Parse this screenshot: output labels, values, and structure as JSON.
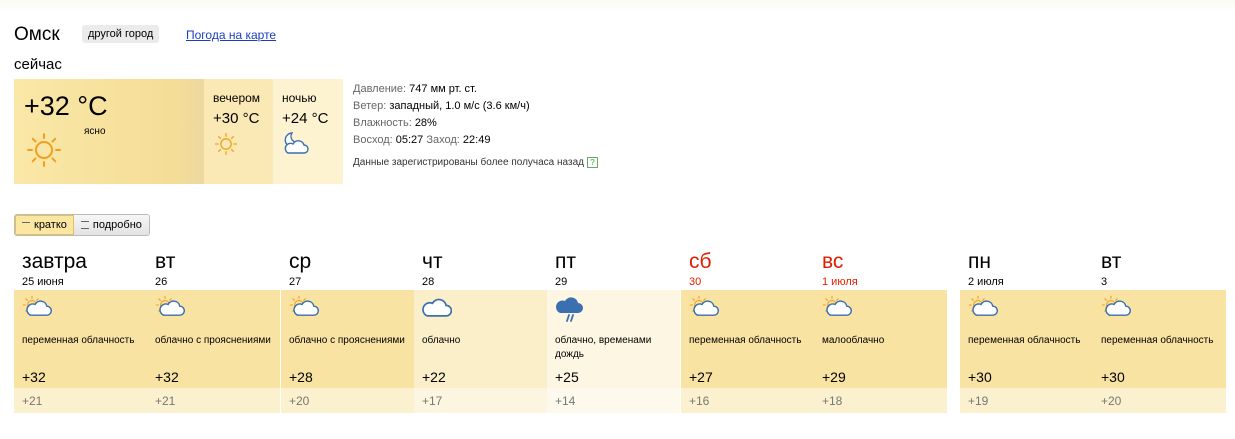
{
  "header": {
    "city": "Омск",
    "other_city_label": "другой город",
    "map_link": "Погода на карте"
  },
  "now": {
    "label": "сейчас",
    "temp": "+32 °C",
    "condition": "ясно",
    "icon": "sun-icon"
  },
  "evening": {
    "label": "вечером",
    "temp": "+30 °C",
    "icon": "sun-icon"
  },
  "night": {
    "label": "ночью",
    "temp": "+24 °C",
    "icon": "moon-cloud-icon"
  },
  "details": {
    "pressure_label": "Давление:",
    "pressure_value": "747 мм рт. ст.",
    "wind_label": "Ветер:",
    "wind_value": "западный, 1.0 м/с (3.6 км/ч)",
    "humidity_label": "Влажность:",
    "humidity_value": "28%",
    "sunrise_label": "Восход:",
    "sunrise_value": "05:27",
    "sunset_label": "Заход:",
    "sunset_value": "22:49",
    "note": "Данные зарегистрированы более получаса назад",
    "help": "?"
  },
  "view_toggle": {
    "brief": "кратко",
    "detailed": "подробно",
    "active": "brief"
  },
  "forecast": [
    {
      "day": "завтра",
      "date": "25 июня",
      "condition": "переменная облачность",
      "high": "+32",
      "low": "+21",
      "icon": "sun-cloud-icon",
      "weekend": false
    },
    {
      "day": "вт",
      "date": "26",
      "condition": "облачно с прояснениями",
      "high": "+32",
      "low": "+21",
      "icon": "sun-cloud-icon",
      "weekend": false
    },
    {
      "day": "ср",
      "date": "27",
      "condition": "облачно с прояснениями",
      "high": "+28",
      "low": "+20",
      "icon": "sun-cloud-icon",
      "weekend": false
    },
    {
      "day": "чт",
      "date": "28",
      "condition": "облачно",
      "high": "+22",
      "low": "+17",
      "icon": "cloud-icon",
      "weekend": false
    },
    {
      "day": "пт",
      "date": "29",
      "condition": "облачно, временами дождь",
      "high": "+25",
      "low": "+14",
      "icon": "rain-cloud-icon",
      "weekend": false
    },
    {
      "day": "сб",
      "date": "30",
      "condition": "переменная облачность",
      "high": "+27",
      "low": "+16",
      "icon": "sun-cloud-icon",
      "weekend": true
    },
    {
      "day": "вс",
      "date": "1 июля",
      "condition": "малооблачно",
      "high": "+29",
      "low": "+18",
      "icon": "sun-cloud-icon",
      "weekend": true
    },
    {
      "day": "пн",
      "date": "2 июля",
      "condition": "переменная облачность",
      "high": "+30",
      "low": "+19",
      "icon": "sun-cloud-icon",
      "weekend": false
    },
    {
      "day": "вт",
      "date": "3",
      "condition": "переменная облачность",
      "high": "+30",
      "low": "+20",
      "icon": "sun-cloud-icon",
      "weekend": false
    }
  ],
  "colors": {
    "accent_sun": "#f0a020",
    "cloud": "#3a6fb0",
    "weekend": "#e02000",
    "link": "#1a3dc1"
  }
}
